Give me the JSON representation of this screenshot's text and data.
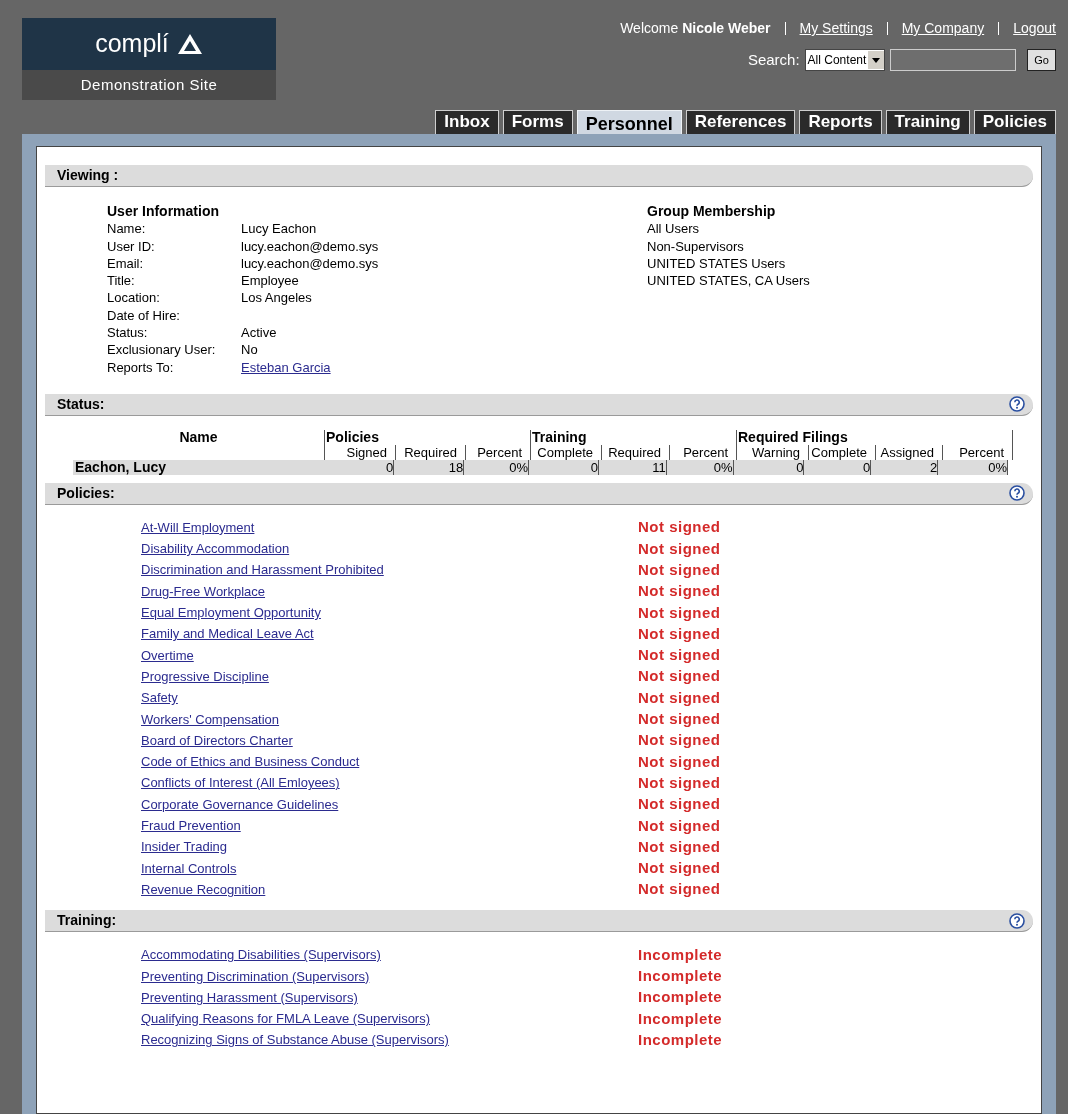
{
  "logo": {
    "name": "complí",
    "subtitle": "Demonstration Site"
  },
  "welcome": {
    "prefix": "Welcome",
    "user": "Nicole Weber"
  },
  "top_links": [
    "My Settings",
    "My Company",
    "Logout"
  ],
  "search": {
    "label": "Search:",
    "scope": "All Content",
    "button": "Go"
  },
  "tabs": [
    {
      "label": "Inbox",
      "selected": false
    },
    {
      "label": "Forms",
      "selected": false
    },
    {
      "label": "Personnel",
      "selected": true
    },
    {
      "label": "References",
      "selected": false
    },
    {
      "label": "Reports",
      "selected": false
    },
    {
      "label": "Training",
      "selected": false
    },
    {
      "label": "Policies",
      "selected": false
    }
  ],
  "viewing": {
    "title": "Viewing :",
    "user_info": {
      "heading": "User Information",
      "fields": [
        {
          "label": "Name:",
          "value": "Lucy Eachon"
        },
        {
          "label": "User ID:",
          "value": "lucy.eachon@demo.sys"
        },
        {
          "label": "Email:",
          "value": "lucy.eachon@demo.sys"
        },
        {
          "label": "Title:",
          "value": "Employee"
        },
        {
          "label": "Location:",
          "value": "Los Angeles"
        },
        {
          "label": "Date of Hire:"
        },
        {
          "label": "Status:",
          "value": "Active"
        },
        {
          "label": "Exclusionary User:",
          "value": "No"
        },
        {
          "label": "Reports To:",
          "value": "Esteban Garcia",
          "kind": "link"
        }
      ]
    },
    "groups": {
      "heading": "Group Membership",
      "items": [
        "All Users",
        "Non-Supervisors",
        "UNITED STATES Users",
        "UNITED STATES, CA Users"
      ]
    }
  },
  "status": {
    "title": "Status:",
    "name_heading": "Name",
    "groups": [
      {
        "heading": "Policies",
        "columns": [
          "Signed",
          "Required",
          "Percent"
        ]
      },
      {
        "heading": "Training",
        "columns": [
          "Complete",
          "Required",
          "Percent"
        ]
      },
      {
        "heading": "Required Filings",
        "columns": [
          "Warning",
          "Complete",
          "Assigned",
          "Percent"
        ]
      }
    ],
    "row": {
      "name": "Eachon, Lucy",
      "values": [
        "0",
        "18",
        "0%",
        "0",
        "11",
        "0%",
        "0",
        "0",
        "2",
        "0%"
      ]
    }
  },
  "policies": {
    "title": "Policies:",
    "items": [
      {
        "name": "At-Will Employment",
        "status": "Not signed"
      },
      {
        "name": "Disability Accommodation",
        "status": "Not signed"
      },
      {
        "name": "Discrimination and Harassment Prohibited",
        "status": "Not signed"
      },
      {
        "name": "Drug-Free Workplace",
        "status": "Not signed"
      },
      {
        "name": "Equal Employment Opportunity",
        "status": "Not signed"
      },
      {
        "name": "Family and Medical Leave Act",
        "status": "Not signed"
      },
      {
        "name": "Overtime",
        "status": "Not signed"
      },
      {
        "name": "Progressive Discipline",
        "status": "Not signed"
      },
      {
        "name": "Safety",
        "status": "Not signed"
      },
      {
        "name": "Workers' Compensation",
        "status": "Not signed"
      },
      {
        "name": "Board of Directors Charter",
        "status": "Not signed"
      },
      {
        "name": "Code of Ethics and Business Conduct",
        "status": "Not signed"
      },
      {
        "name": "Conflicts of Interest (All Emloyees)",
        "status": "Not signed"
      },
      {
        "name": "Corporate Governance Guidelines",
        "status": "Not signed"
      },
      {
        "name": "Fraud Prevention",
        "status": "Not signed"
      },
      {
        "name": "Insider Trading",
        "status": "Not signed"
      },
      {
        "name": "Internal Controls",
        "status": "Not signed"
      },
      {
        "name": "Revenue Recognition",
        "status": "Not signed"
      }
    ]
  },
  "training": {
    "title": "Training:",
    "items": [
      {
        "name": "Accommodating Disabilities (Supervisors)",
        "status": "Incomplete"
      },
      {
        "name": "Preventing Discrimination (Supervisors)",
        "status": "Incomplete"
      },
      {
        "name": "Preventing Harassment (Supervisors)",
        "status": "Incomplete"
      },
      {
        "name": "Qualifying Reasons for FMLA Leave (Supervisors)",
        "status": "Incomplete"
      },
      {
        "name": "Recognizing Signs of Substance Abuse (Supervisors)",
        "status": "Incomplete"
      }
    ]
  }
}
